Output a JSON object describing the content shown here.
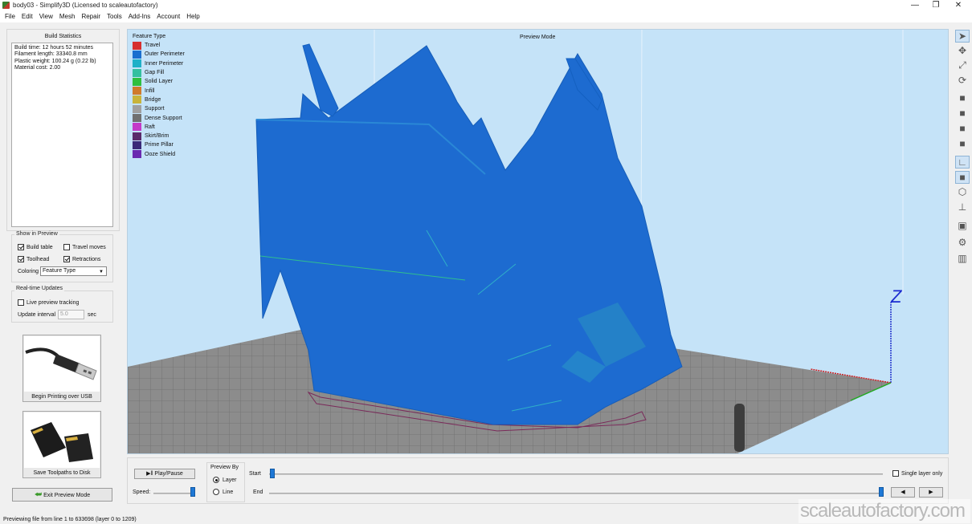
{
  "window": {
    "title": "body03 - Simplify3D (Licensed to scaleautofactory)",
    "min_glyph": "—",
    "max_glyph": "❐",
    "close_glyph": "✕"
  },
  "menu": [
    "File",
    "Edit",
    "View",
    "Mesh",
    "Repair",
    "Tools",
    "Add-Ins",
    "Account",
    "Help"
  ],
  "build_statistics": {
    "title": "Build Statistics",
    "lines": [
      "Build time: 12 hours 52 minutes",
      "Filament length: 33340.8 mm",
      "Plastic weight: 100.24 g (0.22 lb)",
      "Material cost: 2.00"
    ]
  },
  "show_in_preview": {
    "title": "Show in Preview",
    "build_table": {
      "label": "Build table",
      "checked": true
    },
    "travel_moves": {
      "label": "Travel moves",
      "checked": false
    },
    "toolhead": {
      "label": "Toolhead",
      "checked": true
    },
    "retractions": {
      "label": "Retractions",
      "checked": true
    },
    "coloring_label": "Coloring",
    "coloring_value": "Feature Type"
  },
  "realtime_updates": {
    "title": "Real-time Updates",
    "live_preview": {
      "label": "Live preview tracking",
      "checked": false
    },
    "interval_label": "Update interval",
    "interval_value": "5.0",
    "interval_unit": "sec"
  },
  "buttons": {
    "begin_printing": "Begin Printing over USB",
    "save_toolpaths": "Save Toolpaths to Disk",
    "exit_preview": "Exit Preview Mode"
  },
  "viewport": {
    "mode_label": "Preview Mode",
    "legend_title": "Feature Type",
    "legend": [
      {
        "label": "Travel",
        "color": "#d62f2f"
      },
      {
        "label": "Outer Perimeter",
        "color": "#1a6fcf"
      },
      {
        "label": "Inner Perimeter",
        "color": "#1fb0c8"
      },
      {
        "label": "Gap Fill",
        "color": "#33c0a0"
      },
      {
        "label": "Solid Layer",
        "color": "#2fbf3f"
      },
      {
        "label": "Infill",
        "color": "#d07a2a"
      },
      {
        "label": "Bridge",
        "color": "#c9b43a"
      },
      {
        "label": "Support",
        "color": "#a0a0a0"
      },
      {
        "label": "Dense Support",
        "color": "#707070"
      },
      {
        "label": "Raft",
        "color": "#c43ac8"
      },
      {
        "label": "Skirt/Brim",
        "color": "#5a2a6a"
      },
      {
        "label": "Prime Pillar",
        "color": "#3a2a78"
      },
      {
        "label": "Ooze Shield",
        "color": "#6a2ab0"
      }
    ],
    "axis_label": "Z"
  },
  "bottom": {
    "play_pause": "Play/Pause",
    "play_glyph": "▶‖",
    "speed_label": "Speed:",
    "preview_by_title": "Preview By",
    "layer": {
      "label": "Layer",
      "selected": true
    },
    "line": {
      "label": "Line",
      "selected": false
    },
    "start_label": "Start",
    "end_label": "End",
    "single_layer": {
      "label": "Single layer only",
      "checked": false
    },
    "prev_glyph": "◀",
    "next_glyph": "▶"
  },
  "status": "Previewing file from line 1 to 633698 (layer 0 to 1209)",
  "watermark": "scaleautofactory.com"
}
